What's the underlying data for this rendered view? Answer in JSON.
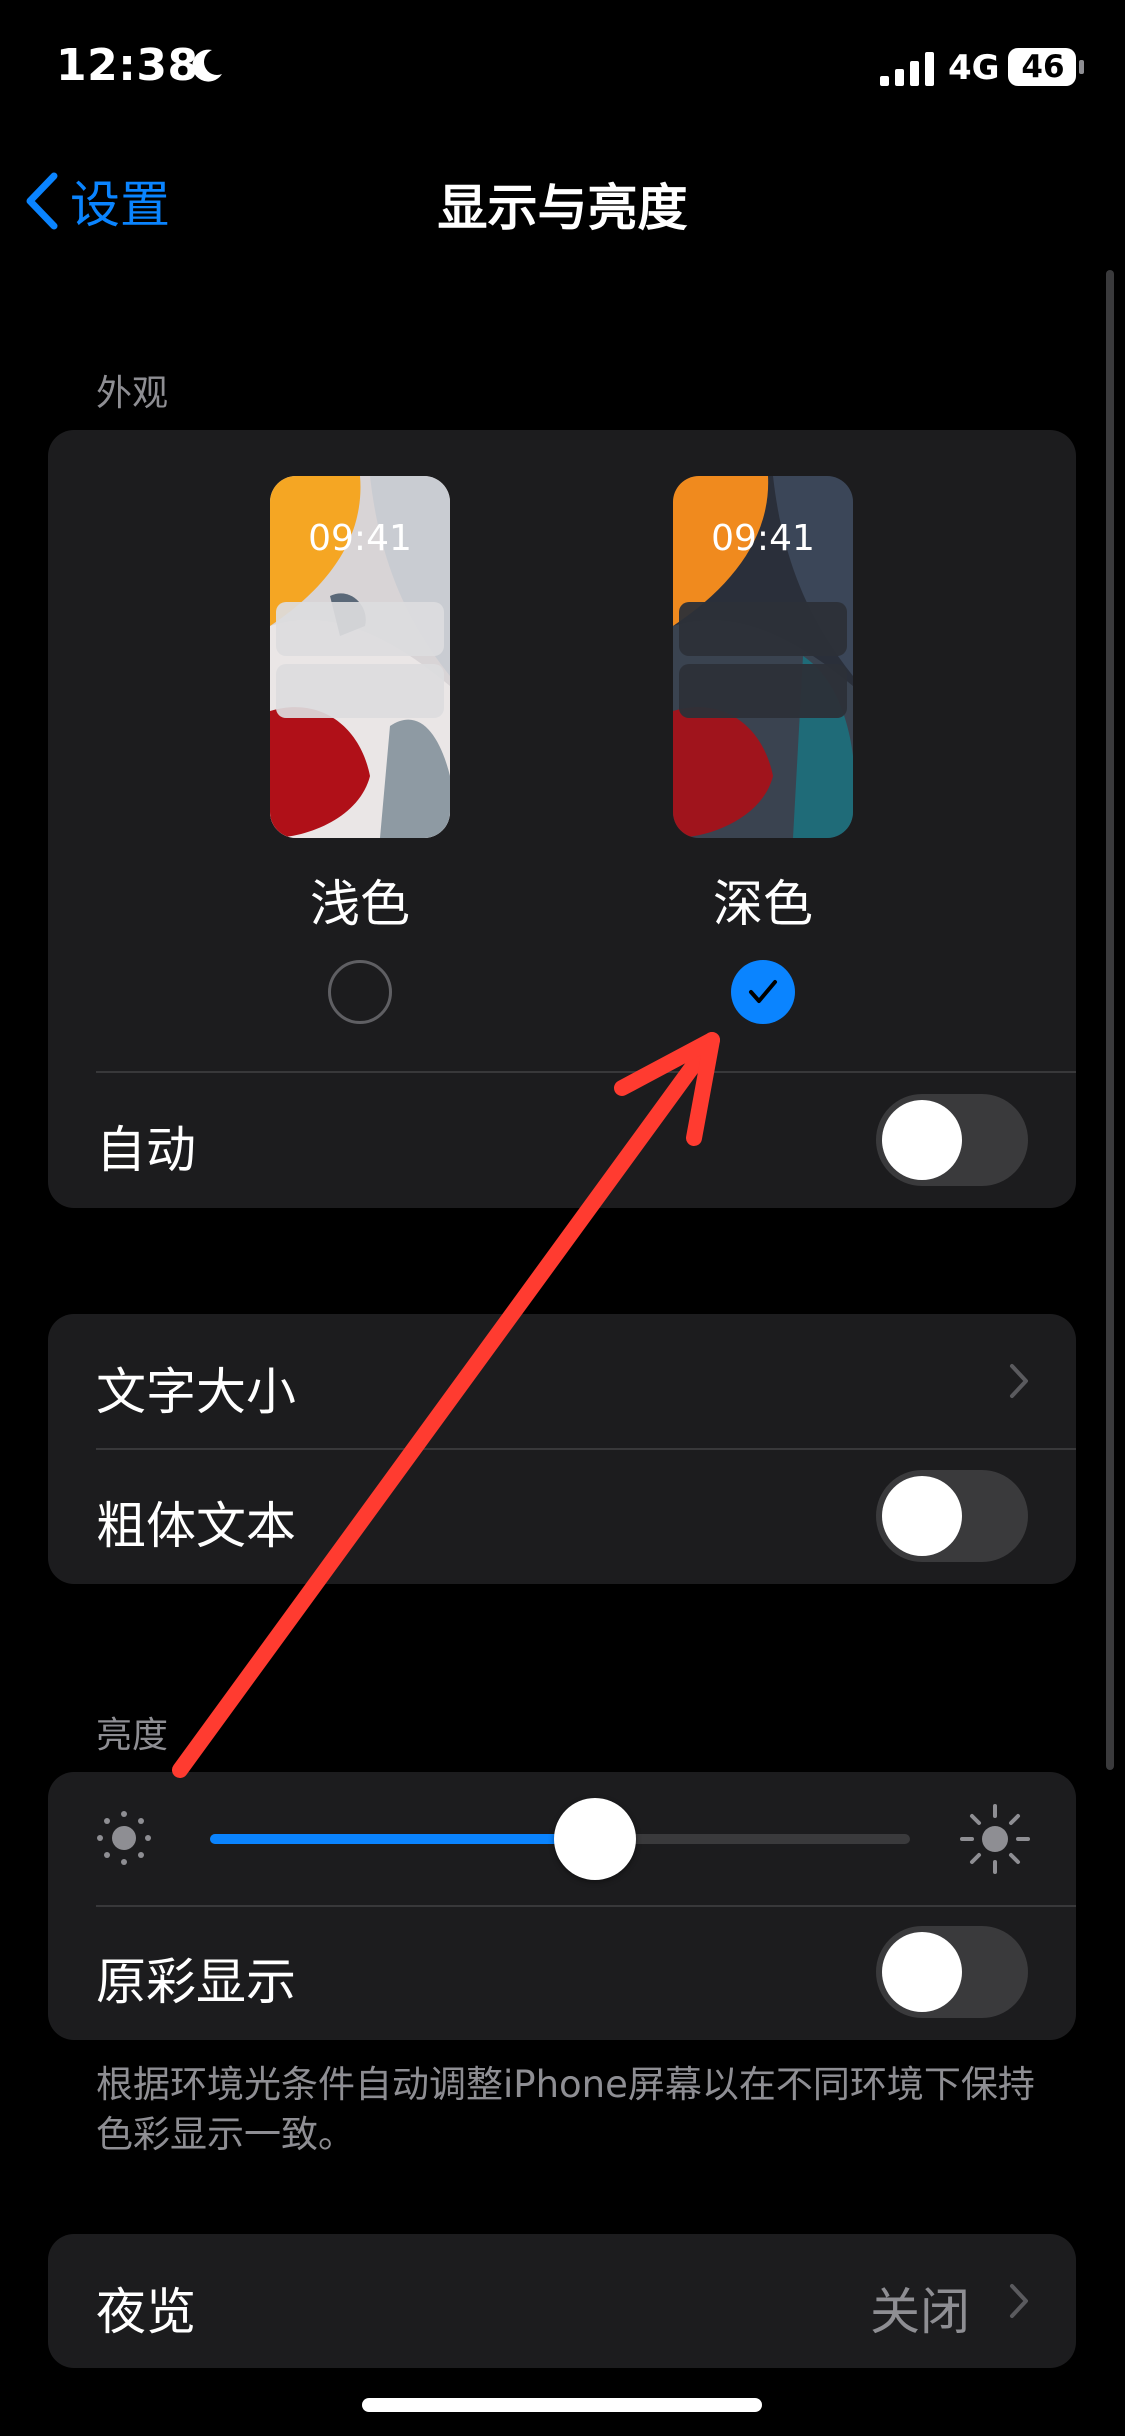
{
  "status_bar": {
    "time": "12:38",
    "network": "4G",
    "battery": "46"
  },
  "nav": {
    "back_label": "设置",
    "title": "显示与亮度"
  },
  "appearance": {
    "header": "外观",
    "preview_time": "09:41",
    "options": [
      {
        "label": "浅色",
        "selected": false
      },
      {
        "label": "深色",
        "selected": true
      }
    ],
    "auto_label": "自动",
    "auto_on": false
  },
  "text": {
    "text_size_label": "文字大小",
    "bold_text_label": "粗体文本",
    "bold_text_on": false
  },
  "brightness": {
    "header": "亮度",
    "level": 0.55,
    "true_tone_label": "原彩显示",
    "true_tone_on": false,
    "footer": "根据环境光条件自动调整iPhone屏幕以在不同环境下保持色彩显示一致。"
  },
  "night_shift": {
    "label": "夜览",
    "value": "关闭"
  },
  "colors": {
    "accent": "#0a84ff",
    "annotation_arrow": "#ff3b30"
  }
}
